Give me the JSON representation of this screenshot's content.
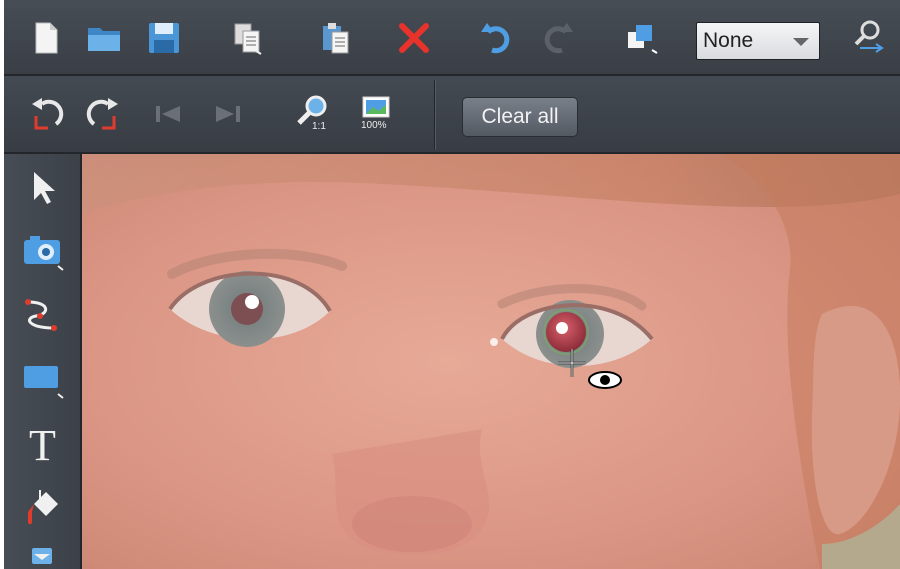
{
  "toolbar_top": {
    "buttons": [
      "new-document",
      "open-folder",
      "save",
      "copy",
      "paste",
      "delete",
      "undo",
      "redo",
      "arrange",
      "magnify-pointer"
    ],
    "blend_select": {
      "value": "None"
    }
  },
  "toolbar_second": {
    "buttons": [
      "rotate-left",
      "rotate-right",
      "previous",
      "next",
      "zoom-1to1",
      "zoom-100"
    ],
    "zoom_1to1_label": "1:1",
    "zoom_100_label": "100%",
    "clear_all_label": "Clear all"
  },
  "sidebar": {
    "tools": [
      "selector",
      "photo",
      "bezier",
      "rectangle",
      "text",
      "fill",
      "more"
    ],
    "text_tool_glyph": "T"
  },
  "colors": {
    "toolbar_bg": "#3d4249",
    "icon_blue": "#5ea2db",
    "delete_red": "#e8322c",
    "red_eye": "#b03a45"
  }
}
